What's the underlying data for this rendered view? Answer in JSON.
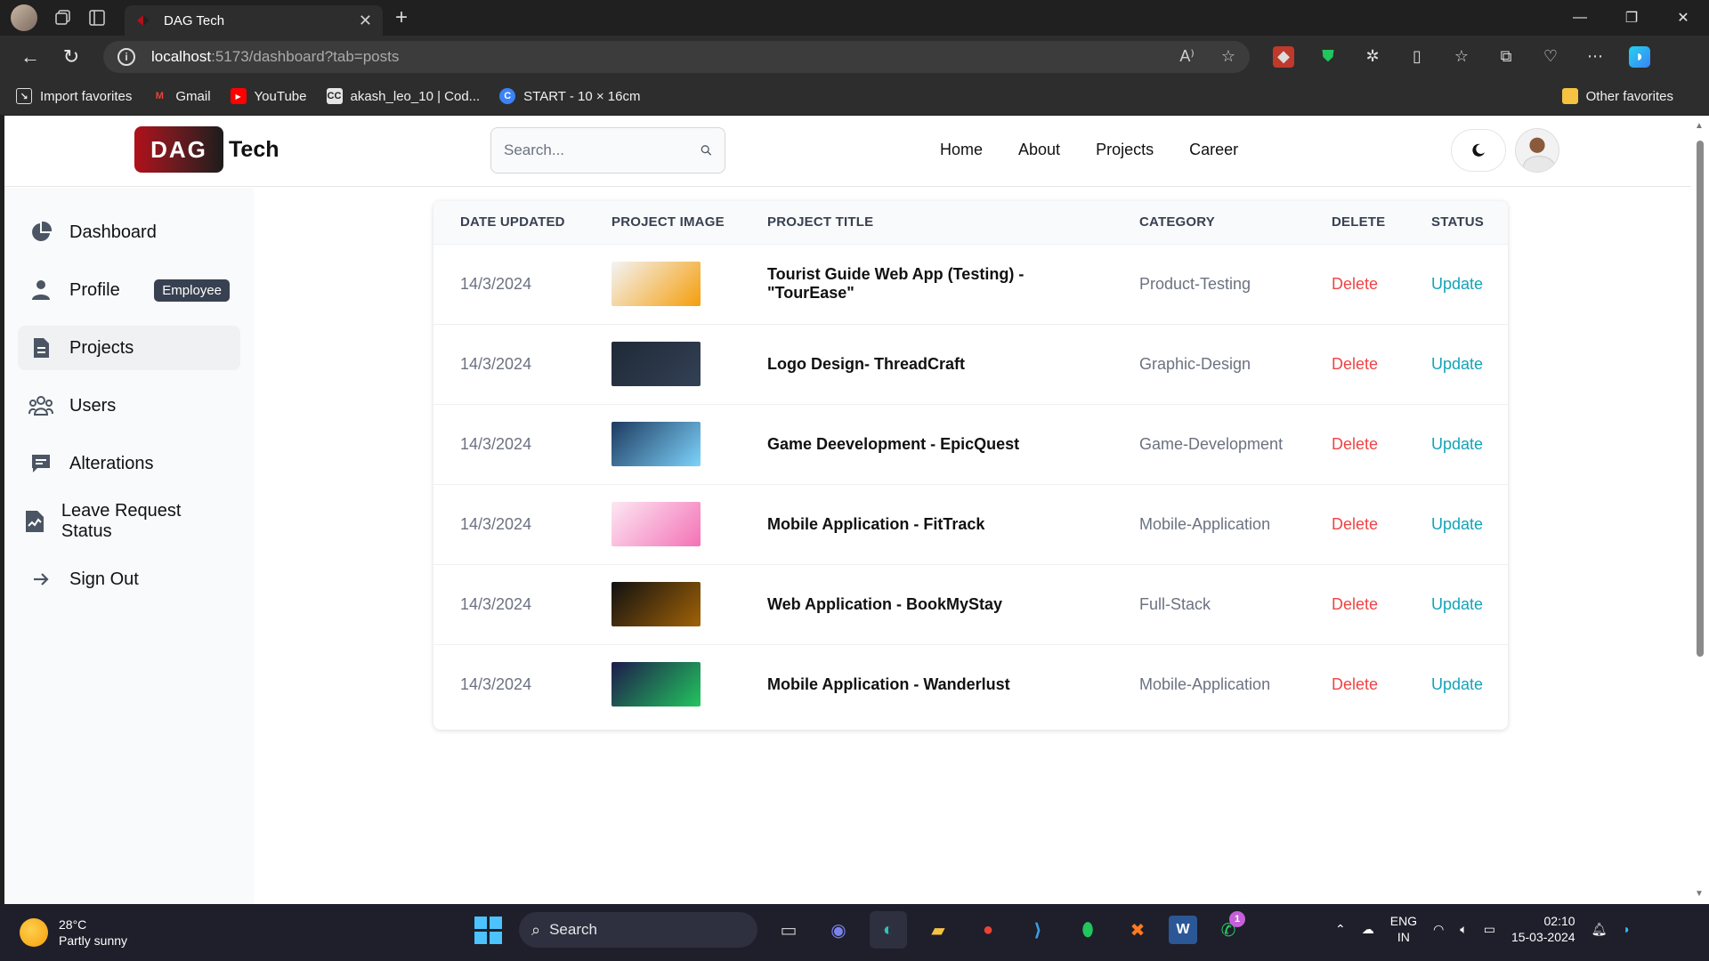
{
  "browser": {
    "tab_title": "DAG Tech",
    "url_host": "localhost",
    "url_path": ":5173/dashboard?tab=posts",
    "favorites": [
      {
        "label": "Import favorites",
        "color": "#2d2d2d"
      },
      {
        "label": "Gmail",
        "color": "#ea4335"
      },
      {
        "label": "YouTube",
        "color": "#ff0000"
      },
      {
        "label": "akash_leo_10 | Cod...",
        "color": "#e5e5e5"
      },
      {
        "label": "START - 10 × 16cm",
        "color": "#3b82f6"
      }
    ],
    "other_favorites": "Other favorites"
  },
  "app": {
    "logo_box": "DAG",
    "logo_text": "Tech",
    "search_placeholder": "Search...",
    "nav": [
      "Home",
      "About",
      "Projects",
      "Career"
    ]
  },
  "sidebar": {
    "items": [
      {
        "label": "Dashboard",
        "icon": "pie-chart-icon"
      },
      {
        "label": "Profile",
        "icon": "user-icon",
        "badge": "Employee"
      },
      {
        "label": "Projects",
        "icon": "document-icon",
        "active": true
      },
      {
        "label": "Users",
        "icon": "users-icon"
      },
      {
        "label": "Alterations",
        "icon": "comment-icon"
      },
      {
        "label": "Leave Request Status",
        "icon": "file-chart-icon"
      },
      {
        "label": "Sign Out",
        "icon": "arrow-right-icon"
      }
    ]
  },
  "table": {
    "headers": [
      "DATE UPDATED",
      "PROJECT IMAGE",
      "PROJECT TITLE",
      "CATEGORY",
      "DELETE",
      "STATUS"
    ],
    "rows": [
      {
        "date": "14/3/2024",
        "title": "Tourist Guide Web App (Testing) - \"TourEase\"",
        "category": "Product-Testing",
        "delete": "Delete",
        "status": "Update",
        "img_colors": [
          "#f3f4f6",
          "#f59e0b"
        ]
      },
      {
        "date": "14/3/2024",
        "title": "Logo Design- ThreadCraft",
        "category": "Graphic-Design",
        "delete": "Delete",
        "status": "Update",
        "img_colors": [
          "#1f2937",
          "#334155"
        ]
      },
      {
        "date": "14/3/2024",
        "title": "Game Deevelopment - EpicQuest",
        "category": "Game-Development",
        "delete": "Delete",
        "status": "Update",
        "img_colors": [
          "#1e3a5f",
          "#7dd3fc"
        ]
      },
      {
        "date": "14/3/2024",
        "title": "Mobile Application - FitTrack",
        "category": "Mobile-Application",
        "delete": "Delete",
        "status": "Update",
        "img_colors": [
          "#fce7f3",
          "#f472b6"
        ]
      },
      {
        "date": "14/3/2024",
        "title": "Web Application - BookMyStay",
        "category": "Full-Stack",
        "delete": "Delete",
        "status": "Update",
        "img_colors": [
          "#111111",
          "#a16207"
        ]
      },
      {
        "date": "14/3/2024",
        "title": "Mobile Application - Wanderlust",
        "category": "Mobile-Application",
        "delete": "Delete",
        "status": "Update",
        "img_colors": [
          "#1e1b4b",
          "#22c55e"
        ]
      }
    ]
  },
  "taskbar": {
    "temp": "28°C",
    "weather": "Partly sunny",
    "search": "Search",
    "lang1": "ENG",
    "lang2": "IN",
    "time": "02:10",
    "date": "15-03-2024",
    "whatsapp_badge": "1"
  }
}
